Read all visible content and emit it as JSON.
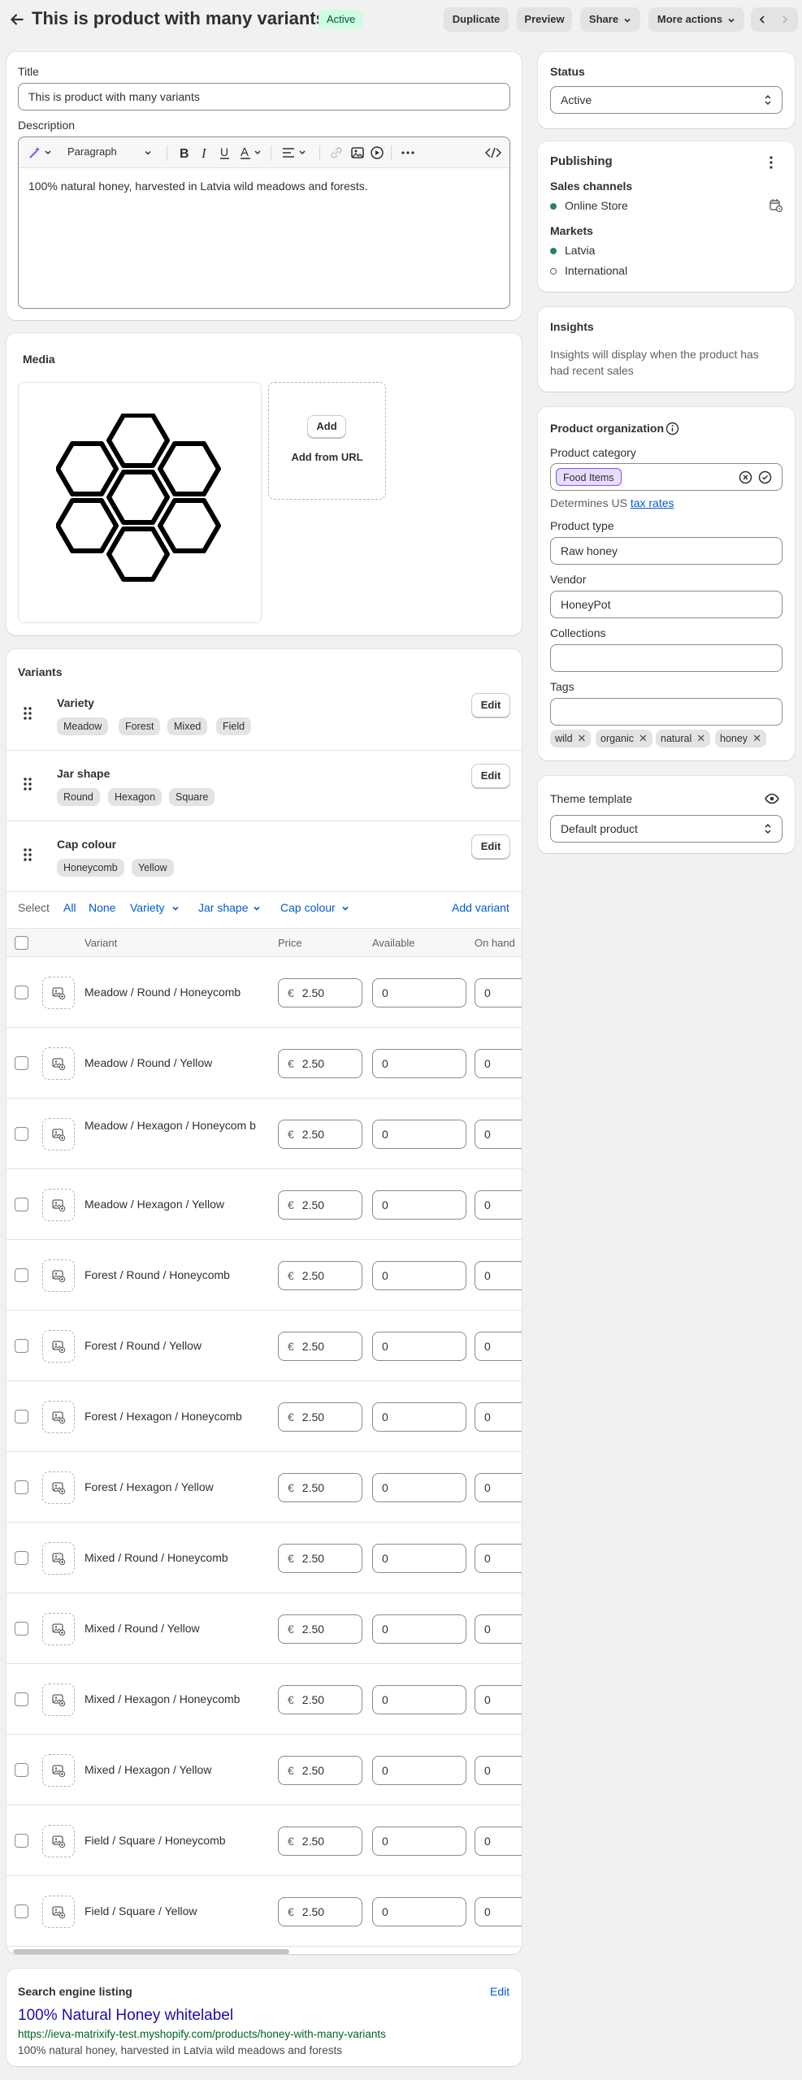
{
  "header": {
    "title": "This is product with many variants",
    "status_badge": "Active",
    "buttons": {
      "duplicate": "Duplicate",
      "preview": "Preview",
      "share": "Share",
      "more_actions": "More actions"
    }
  },
  "main": {
    "title_label": "Title",
    "title_value": "This is product with many variants",
    "description_label": "Description",
    "editor": {
      "paragraph_select": "Paragraph"
    },
    "description_text": "100% natural honey, harvested in Latvia wild meadows and forests.",
    "media": {
      "heading": "Media",
      "add_button": "Add",
      "add_from_url": "Add from URL"
    },
    "variants": {
      "heading": "Variants",
      "edit_label": "Edit",
      "options": [
        {
          "name": "Variety",
          "values": [
            "Meadow",
            "Forest",
            "Mixed",
            "Field"
          ]
        },
        {
          "name": "Jar shape",
          "values": [
            "Round",
            "Hexagon",
            "Square"
          ]
        },
        {
          "name": "Cap colour",
          "values": [
            "Honeycomb",
            "Yellow"
          ]
        }
      ],
      "select_bar": {
        "select": "Select",
        "all": "All",
        "none": "None",
        "variety": "Variety",
        "jar_shape": "Jar shape",
        "cap_colour": "Cap colour",
        "add_variant": "Add variant"
      },
      "columns": [
        "Variant",
        "Price",
        "Available",
        "On hand"
      ],
      "currency": "€",
      "rows": [
        {
          "name": "Meadow / Round / Honeycomb",
          "price": "2.50",
          "available": "0",
          "on_hand": "0"
        },
        {
          "name": "Meadow / Round / Yellow",
          "price": "2.50",
          "available": "0",
          "on_hand": "0"
        },
        {
          "name": "Meadow / Hexagon / Honeycom b",
          "price": "2.50",
          "available": "0",
          "on_hand": "0"
        },
        {
          "name": "Meadow / Hexagon / Yellow",
          "price": "2.50",
          "available": "0",
          "on_hand": "0"
        },
        {
          "name": "Forest / Round / Honeycomb",
          "price": "2.50",
          "available": "0",
          "on_hand": "0"
        },
        {
          "name": "Forest / Round / Yellow",
          "price": "2.50",
          "available": "0",
          "on_hand": "0"
        },
        {
          "name": "Forest / Hexagon / Honeycomb",
          "price": "2.50",
          "available": "0",
          "on_hand": "0"
        },
        {
          "name": "Forest / Hexagon / Yellow",
          "price": "2.50",
          "available": "0",
          "on_hand": "0"
        },
        {
          "name": "Mixed / Round / Honeycomb",
          "price": "2.50",
          "available": "0",
          "on_hand": "0"
        },
        {
          "name": "Mixed / Round / Yellow",
          "price": "2.50",
          "available": "0",
          "on_hand": "0"
        },
        {
          "name": "Mixed / Hexagon / Honeycomb",
          "price": "2.50",
          "available": "0",
          "on_hand": "0"
        },
        {
          "name": "Mixed / Hexagon / Yellow",
          "price": "2.50",
          "available": "0",
          "on_hand": "0"
        },
        {
          "name": "Field / Square / Honeycomb",
          "price": "2.50",
          "available": "0",
          "on_hand": "0"
        },
        {
          "name": "Field / Square / Yellow",
          "price": "2.50",
          "available": "0",
          "on_hand": "0"
        }
      ]
    },
    "seo": {
      "heading": "Search engine listing",
      "edit": "Edit",
      "title": "100% Natural Honey whitelabel",
      "url": "https://ieva-matrixify-test.myshopify.com/products/honey-with-many-variants",
      "description": "100% natural honey, harvested in Latvia wild meadows and forests"
    }
  },
  "sidebar": {
    "status": {
      "heading": "Status",
      "value": "Active"
    },
    "publishing": {
      "heading": "Publishing",
      "sales_channels_label": "Sales channels",
      "sales_channels": [
        "Online Store"
      ],
      "markets_label": "Markets",
      "markets": [
        "Latvia",
        "International"
      ]
    },
    "insights": {
      "heading": "Insights",
      "text": "Insights will display when the product has had recent sales"
    },
    "organization": {
      "heading": "Product organization",
      "category_label": "Product category",
      "category_value": "Food Items",
      "tax_note": "Determines US",
      "tax_link": "tax rates",
      "type_label": "Product type",
      "type_value": "Raw honey",
      "vendor_label": "Vendor",
      "vendor_value": "HoneyPot",
      "collections_label": "Collections",
      "collections_value": "",
      "tags_label": "Tags",
      "tags_value": "",
      "tags": [
        "wild",
        "organic",
        "natural",
        "honey"
      ]
    },
    "theme": {
      "heading": "Theme template",
      "value": "Default product"
    }
  },
  "colors": {
    "accent": "#005bd3",
    "active_badge_bg": "#cdfee1",
    "seo_title": "#1a0dab",
    "seo_url": "#006621",
    "category_chip": "#e8dcff"
  }
}
